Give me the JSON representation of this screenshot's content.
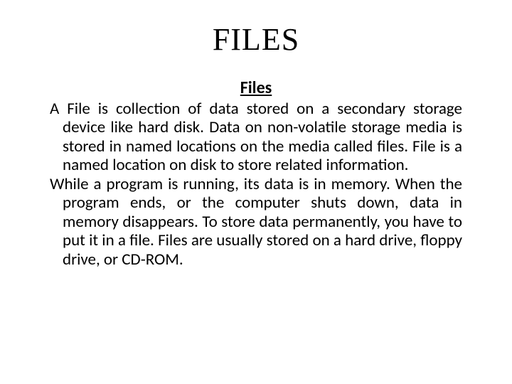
{
  "title": "FILES",
  "subheading": " Files",
  "paragraph1": "A File is collection of data stored on a secondary storage device like hard disk. Data on non-volatile storage media is stored in named locations on the media called files. File is a named location on disk to store related information.",
  "paragraph2": "While a program is running, its data is in memory. When the program ends, or the computer shuts down, data in memory disappears. To store data permanently, you have to put it in a file. Files are usually stored on a hard drive, floppy drive, or CD-ROM."
}
